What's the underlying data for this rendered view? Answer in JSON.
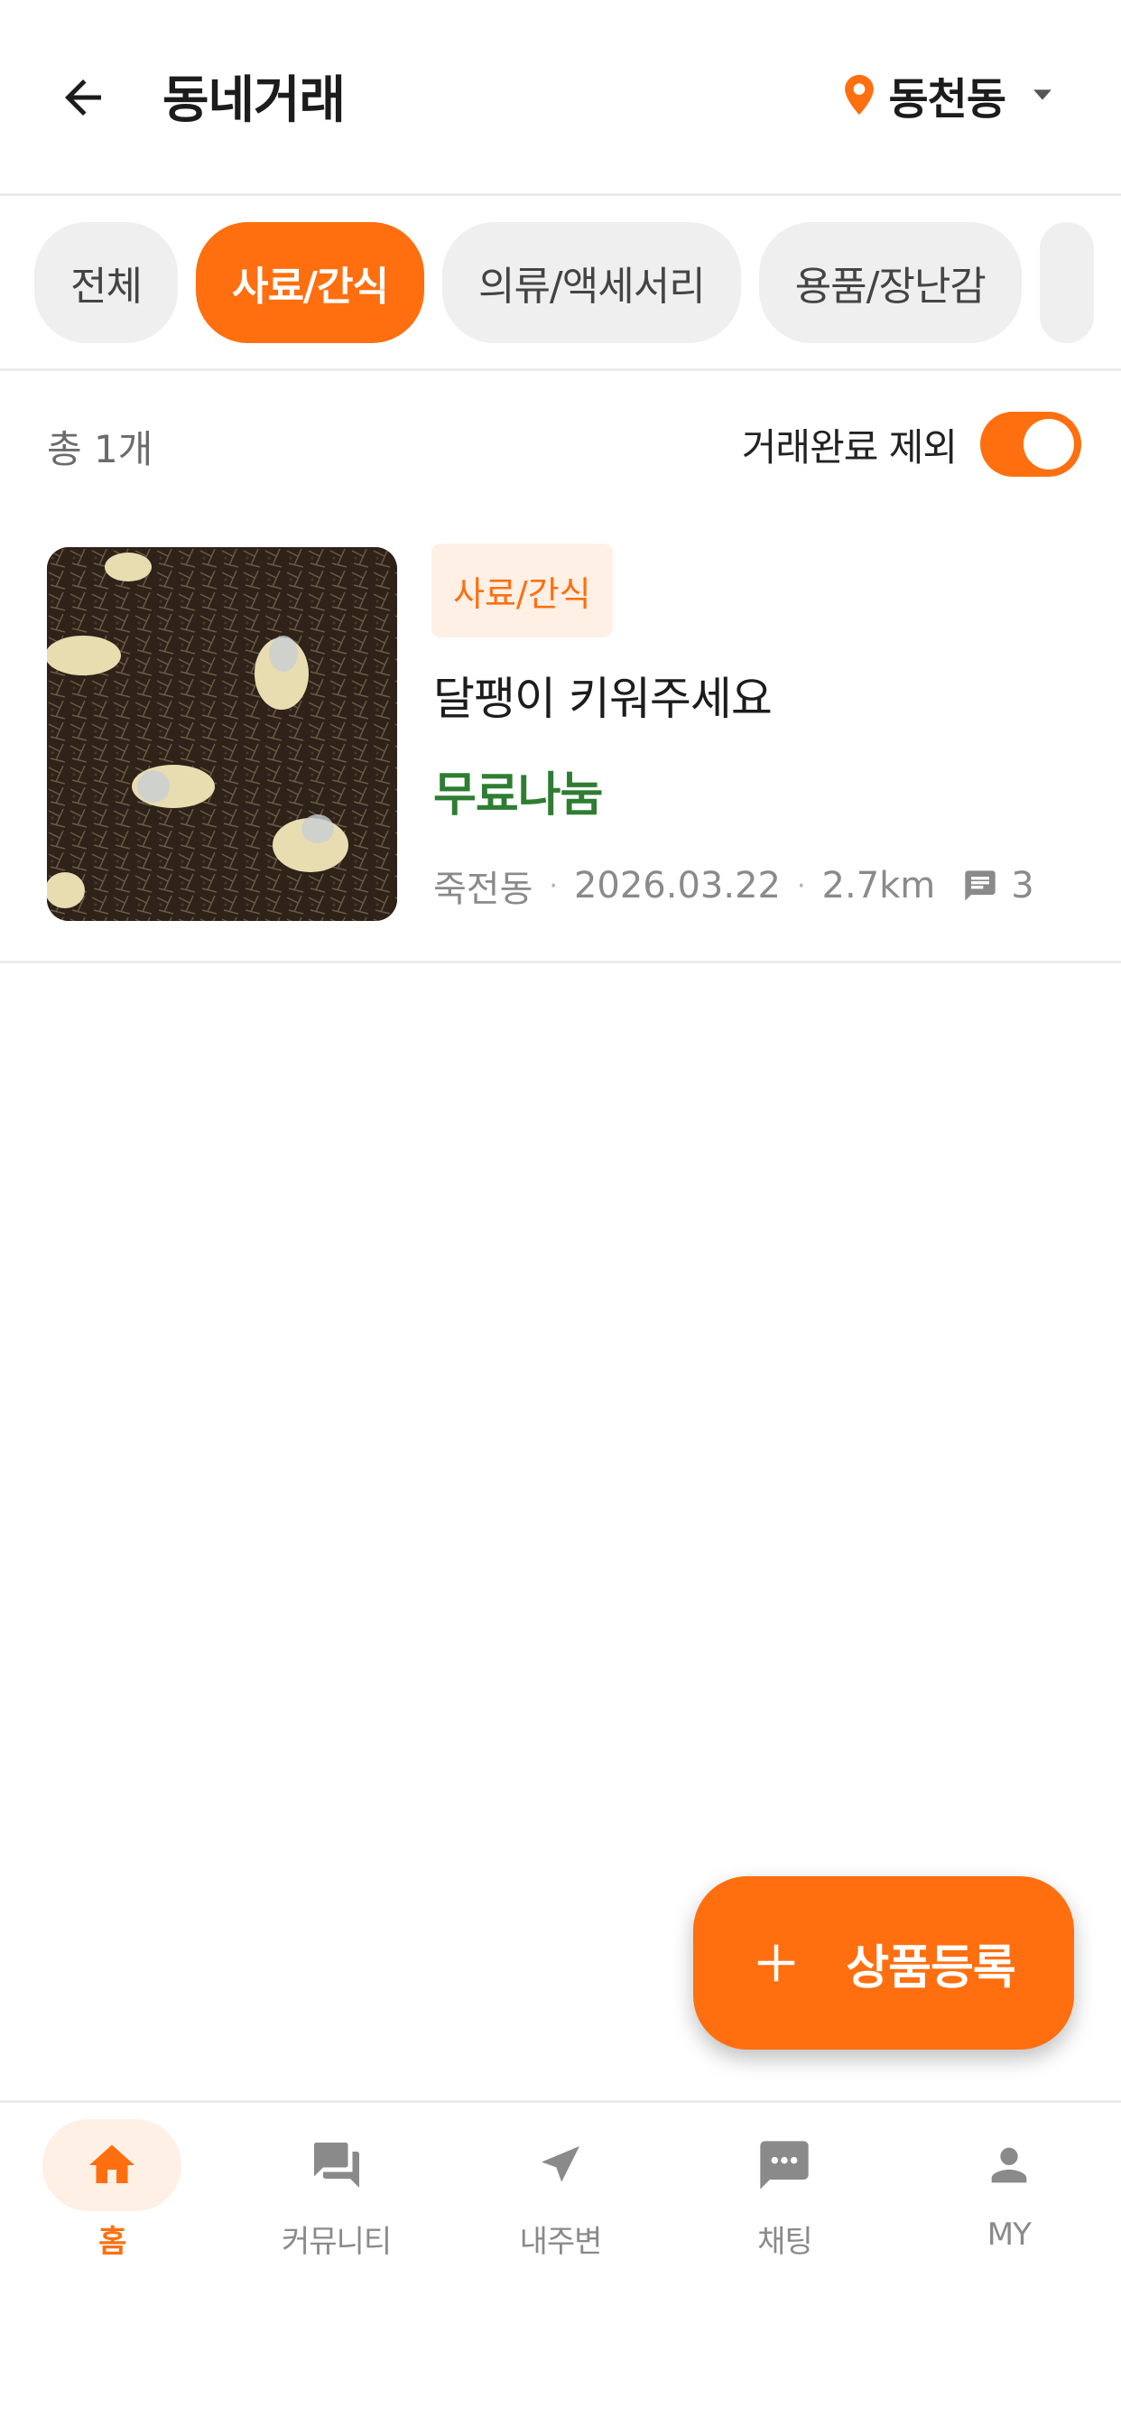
{
  "header": {
    "title": "동네거래",
    "location": "동천동"
  },
  "categories": [
    {
      "label": "전체",
      "active": false
    },
    {
      "label": "사료/간식",
      "active": true
    },
    {
      "label": "의류/액세서리",
      "active": false
    },
    {
      "label": "용품/장난감",
      "active": false
    }
  ],
  "list_info": {
    "count": "총 1개",
    "filter_label": "거래완료 제외",
    "filter_on": true
  },
  "listing": {
    "tag": "사료/간식",
    "title": "달팽이 키워주세요",
    "price": "무료나눔",
    "location": "죽전동",
    "date": "2026.03.22",
    "distance": "2.7km",
    "comments": "3"
  },
  "fab": {
    "label": "상품등록"
  },
  "bottom_nav": [
    {
      "label": "홈",
      "icon": "home-icon",
      "active": true
    },
    {
      "label": "커뮤니티",
      "icon": "forum-icon",
      "active": false
    },
    {
      "label": "내주변",
      "icon": "navigation-arrow-icon",
      "active": false
    },
    {
      "label": "채팅",
      "icon": "chat-bubble-icon",
      "active": false
    },
    {
      "label": "MY",
      "icon": "person-icon",
      "active": false
    }
  ],
  "colors": {
    "accent": "#ff6f0f",
    "price_green": "#2e7d32",
    "inactive_gray": "#8a8a8a"
  }
}
